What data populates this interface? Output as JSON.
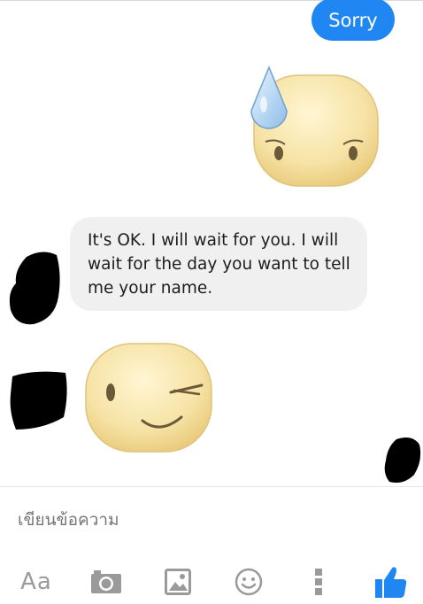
{
  "messages": {
    "outgoing_text": "Sorry",
    "incoming_text": "It's OK. I will wait for you. I will wait for the day you want to tell me your name."
  },
  "stickers": [
    {
      "name": "sweat-drop-sticker",
      "expression": "worried with sweat drop"
    },
    {
      "name": "wink-sticker",
      "expression": "winking smile"
    }
  ],
  "composer": {
    "placeholder": "เขียนข้อความ"
  },
  "toolbar": {
    "text_label": "Aa",
    "icons": [
      "camera-icon",
      "image-icon",
      "emoji-icon",
      "more-icon",
      "thumbs-up-icon"
    ]
  },
  "colors": {
    "accent": "#1f86f2",
    "incoming_bubble": "#f0f0f1",
    "icon_gray": "#9a9a9a",
    "sticker_face": "#f6e2a4"
  }
}
